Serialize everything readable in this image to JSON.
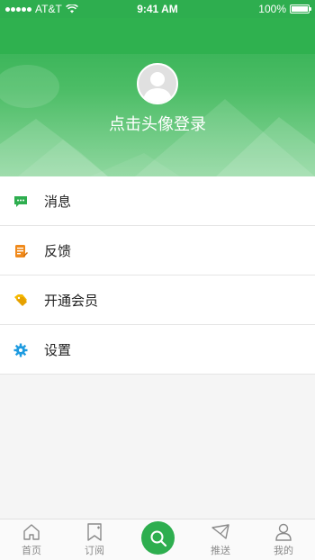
{
  "status_bar": {
    "carrier": "AT&T",
    "time": "9:41 AM",
    "battery": "100%",
    "battery_level": 1.0
  },
  "header": {
    "login_prompt": "点击头像登录",
    "avatar_icon": "default-avatar-icon"
  },
  "menu": [
    {
      "label": "消息",
      "icon": "message-icon",
      "color": "#2eae4f"
    },
    {
      "label": "反馈",
      "icon": "feedback-icon",
      "color": "#f08a1c"
    },
    {
      "label": "开通会员",
      "icon": "tag-icon",
      "color": "#f5b800"
    },
    {
      "label": "设置",
      "icon": "gear-icon",
      "color": "#1e9be0"
    }
  ],
  "tab_bar": {
    "tabs": [
      {
        "label": "首页",
        "icon": "home-icon"
      },
      {
        "label": "订阅",
        "icon": "subscribe-icon"
      },
      {
        "label": "",
        "icon": "search-icon"
      },
      {
        "label": "推送",
        "icon": "send-icon"
      },
      {
        "label": "我的",
        "icon": "profile-icon"
      }
    ]
  },
  "colors": {
    "primary": "#2eae4f",
    "background": "#f5f5f5",
    "tab_text": "#8a8a8a"
  }
}
